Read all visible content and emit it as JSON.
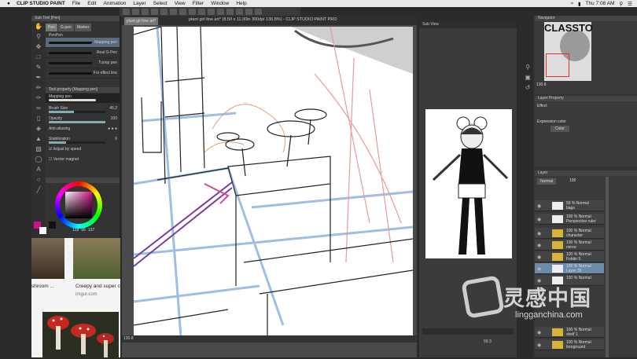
{
  "menubar": {
    "app": "CLIP STUDIO PAINT",
    "items": [
      "File",
      "Edit",
      "Animation",
      "Layer",
      "Select",
      "View",
      "Filter",
      "Window",
      "Help"
    ],
    "clock": "Thu 7:08 AM"
  },
  "document": {
    "title": "plant girl line art* (8.50 x 11.00in 300dpi 130.8%)  - CLIP STUDIO PAINT PRO",
    "tab": "plant girl line art*",
    "zoom": "130.8",
    "subview_zoom": "59.3"
  },
  "subtool": {
    "header": "Sub Tool [Pen]",
    "tabs": [
      "Pen",
      "G-pen",
      "Marker"
    ],
    "group_label": "PenPen",
    "brushes": [
      "Mapping pen",
      "Real G-Pen",
      "Turnip pen",
      "For effect line"
    ]
  },
  "tool_property": {
    "header": "Tool property [Mapping pen]",
    "brush_name": "Mapping pen",
    "brush_size_label": "Brush Size",
    "brush_size": "45.2",
    "opacity_label": "Opacity",
    "opacity": "100",
    "antialias_label": "Anti-aliasing",
    "stabilization_label": "Stabilization",
    "stabilization": "6",
    "adjust_label": "Adjust by speed",
    "vector_label": "Vector magnet"
  },
  "color": {
    "values": [
      "128",
      "66",
      "137"
    ],
    "hue_color": "#d0108a"
  },
  "browser": {
    "caption1": "shroom ...",
    "caption2": "Creepy and super c",
    "source": "imgur.com"
  },
  "subview": {
    "header": "Sub View"
  },
  "navigator": {
    "header": "Navigator",
    "zoom": "130.8",
    "brand": "CLASSTO"
  },
  "layer_property": {
    "header": "Layer Property",
    "effect_label": "Effect",
    "expression_label": "Expression color",
    "expression_value": "Color"
  },
  "layers": {
    "header": "Layer",
    "blend": "Normal",
    "opacity": "100",
    "rows": [
      {
        "line1": "59 % Normal",
        "line2": "bags"
      },
      {
        "line1": "100 % Normal",
        "line2": "Perspective ruler"
      },
      {
        "line1": "100 % Normal",
        "line2": "character"
      },
      {
        "line1": "100 % Normal",
        "line2": "mirror"
      },
      {
        "line1": "100 % Normal",
        "line2": "Folder 5"
      },
      {
        "line1": "100 % Normal",
        "line2": "Layer 39"
      },
      {
        "line1": "100 % Normal",
        "line2": ""
      },
      {
        "line1": "100 % Normal",
        "line2": "shelf 1"
      },
      {
        "line1": "100 % Normal",
        "line2": "foreground"
      }
    ]
  },
  "watermark": {
    "text": "灵感中国",
    "url": "lingganchina.com"
  }
}
